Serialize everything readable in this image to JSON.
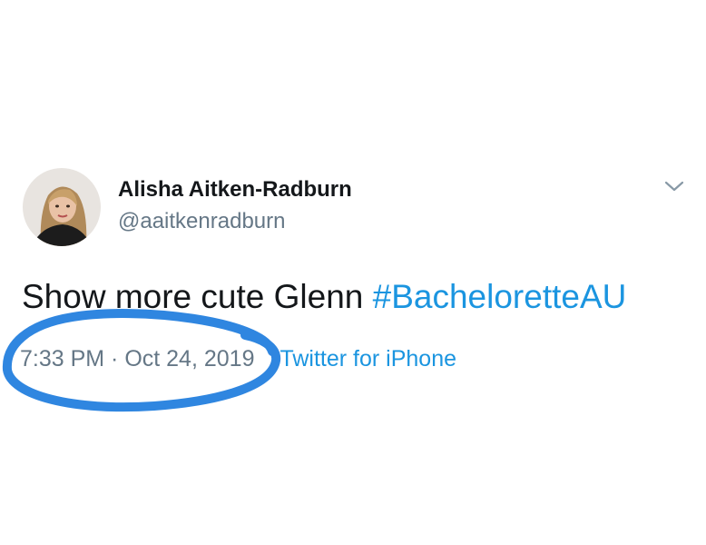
{
  "tweet": {
    "author": {
      "display_name": "Alisha Aitken-Radburn",
      "handle": "@aaitkenradburn"
    },
    "text_plain": "Show more cute Glenn ",
    "hashtag": "#BacheloretteAU",
    "timestamp": "7:33 PM · Oct 24, 2019",
    "source": "Twitter for iPhone"
  },
  "icons": {
    "menu": "chevron-down-icon"
  },
  "colors": {
    "link": "#1b95e0",
    "secondary_text": "#657786",
    "primary_text": "#14171a",
    "annotation": "#2f86e0"
  }
}
